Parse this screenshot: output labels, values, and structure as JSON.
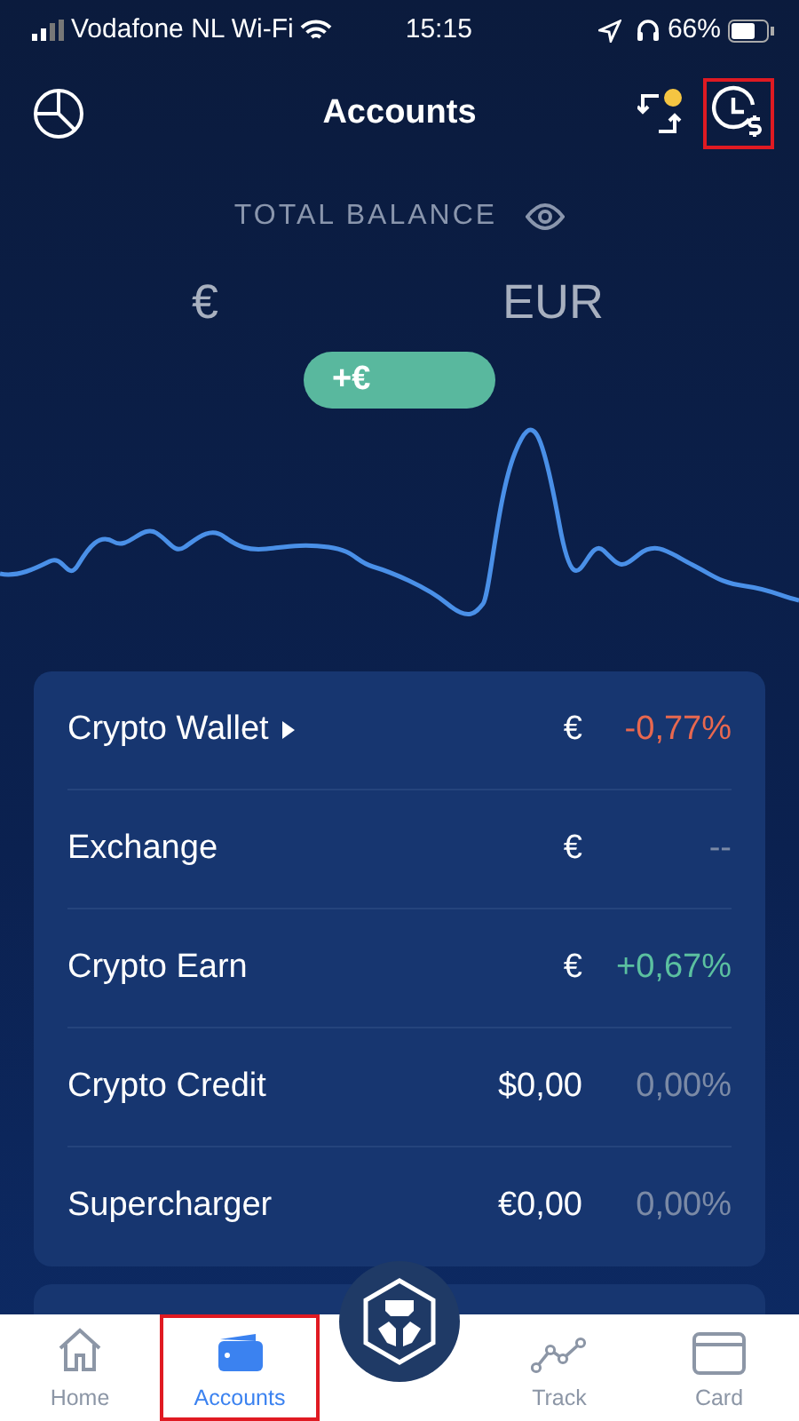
{
  "status_bar": {
    "carrier": "Vodafone NL Wi-Fi",
    "time": "15:15",
    "battery": "66%"
  },
  "header": {
    "title": "Accounts",
    "actions": [
      {
        "kind": "transfer",
        "badge": true,
        "highlighted": false
      },
      {
        "kind": "history",
        "badge": false,
        "highlighted": true
      }
    ]
  },
  "balance": {
    "label": "TOTAL BALANCE",
    "currency_symbol": "€",
    "currency_code": "EUR",
    "change": "+€"
  },
  "accounts": [
    {
      "name": "Crypto Wallet",
      "expandable": true,
      "amount": "€",
      "change": "-0,77%",
      "color": "#e8684f"
    },
    {
      "name": "Exchange",
      "expandable": false,
      "amount": "€",
      "change": "--",
      "color": "#7b8aa6"
    },
    {
      "name": "Crypto Earn",
      "expandable": false,
      "amount": "€",
      "change": "+0,67%",
      "color": "#5bc0a0"
    },
    {
      "name": "Crypto Credit",
      "expandable": false,
      "amount": "$0,00",
      "change": "0,00%",
      "color": "#7b8aa6"
    },
    {
      "name": "Supercharger",
      "expandable": false,
      "amount": "€0,00",
      "change": "0,00%",
      "color": "#7b8aa6"
    }
  ],
  "tab_bar": [
    {
      "kind": "home",
      "label": "Home",
      "selected": false,
      "highlighted": false
    },
    {
      "kind": "accounts",
      "label": "Accounts",
      "selected": true,
      "highlighted": true
    },
    {
      "kind": "logo",
      "selected": false,
      "highlighted": false
    },
    {
      "kind": "track",
      "label": "Track",
      "selected": false,
      "highlighted": false
    },
    {
      "kind": "card",
      "label": "Card",
      "selected": false,
      "highlighted": false
    }
  ]
}
